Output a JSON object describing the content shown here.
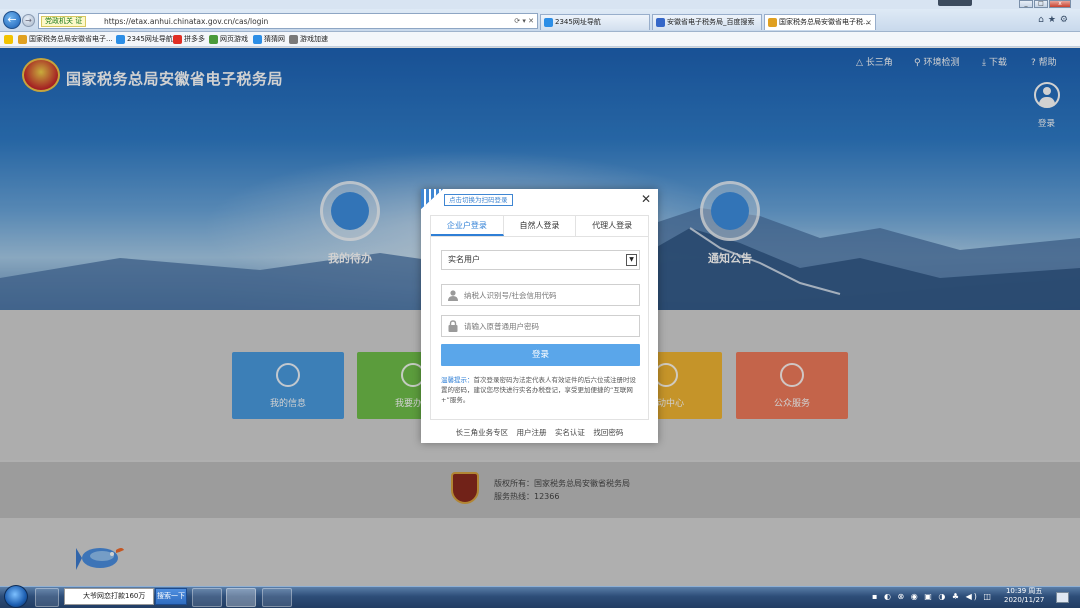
{
  "browser": {
    "address_tag": "党政机关 证",
    "url": "https://etax.anhui.chinatax.gov.cn/cas/login",
    "address_icons": "⟳ ▾ ✕",
    "tabs": [
      {
        "label": "2345网址导航",
        "color": "#2c8ee6"
      },
      {
        "label": "安徽省电子税务局_百度搜索",
        "color": "#3567c8"
      },
      {
        "label": "国家税务总局安徽省电子税...",
        "color": "#e0a020",
        "active": true
      }
    ],
    "tab_close": "×",
    "right_icons": "⌂★⚙",
    "favorites": [
      {
        "label": "国家税务总局安徽省电子...",
        "color": "#e0a020"
      },
      {
        "label": "2345网址导航",
        "color": "#2c8ee6"
      },
      {
        "label": "拼多多",
        "color": "#e02e24"
      },
      {
        "label": "网页游戏",
        "color": "#4a9a3a"
      },
      {
        "label": "猜猜网",
        "color": "#2c8ee6"
      },
      {
        "label": "游戏加速",
        "color": "#7a7a7a"
      }
    ]
  },
  "site": {
    "title": "国家税务总局安徽省电子税务局",
    "top_nav": [
      "长三角",
      "环境检测",
      "下载",
      "帮助"
    ],
    "login_label": "登录",
    "quick": [
      "我的待办",
      "通知公告"
    ],
    "cards": [
      {
        "label": "我的信息",
        "color": "#4a9be0"
      },
      {
        "label": "我要办税",
        "color": "#6fbf4a"
      },
      {
        "label": "互动中心",
        "color": "#f1b533"
      },
      {
        "label": "公众服务",
        "color": "#ef7b5b"
      }
    ],
    "footer": {
      "copyright": "版权所有：国家税务总局安徽省税务局",
      "hotline": "服务热线：12366"
    }
  },
  "modal": {
    "qr_tip": "点击切换为扫码登录",
    "close": "✕",
    "tabs": [
      "企业户登录",
      "自然人登录",
      "代理人登录"
    ],
    "select_value": "实名用户",
    "taxpayer_placeholder": "纳税人识别号/社会信用代码",
    "password_placeholder": "请输入原普通用户密码",
    "login_button": "登录",
    "tip_label": "温馨提示：",
    "tip_text": "首次登录密码为法定代表人有效证件的后六位或注册时设置的密码，建议您尽快进行实名办税登记，享受更加便捷的“互联网+”服务。",
    "links": [
      "长三角业务专区",
      "用户注册",
      "实名认证",
      "找回密码"
    ]
  },
  "taskbar": {
    "search_text": "大爷网恋打款160万",
    "search_button": "搜索一下",
    "tray_icons": "▪ ◐ ⊗ ◉ ▣ ◑ ♣ ◀) ◫",
    "time": "10:39 周五",
    "date": "2020/11/27"
  }
}
